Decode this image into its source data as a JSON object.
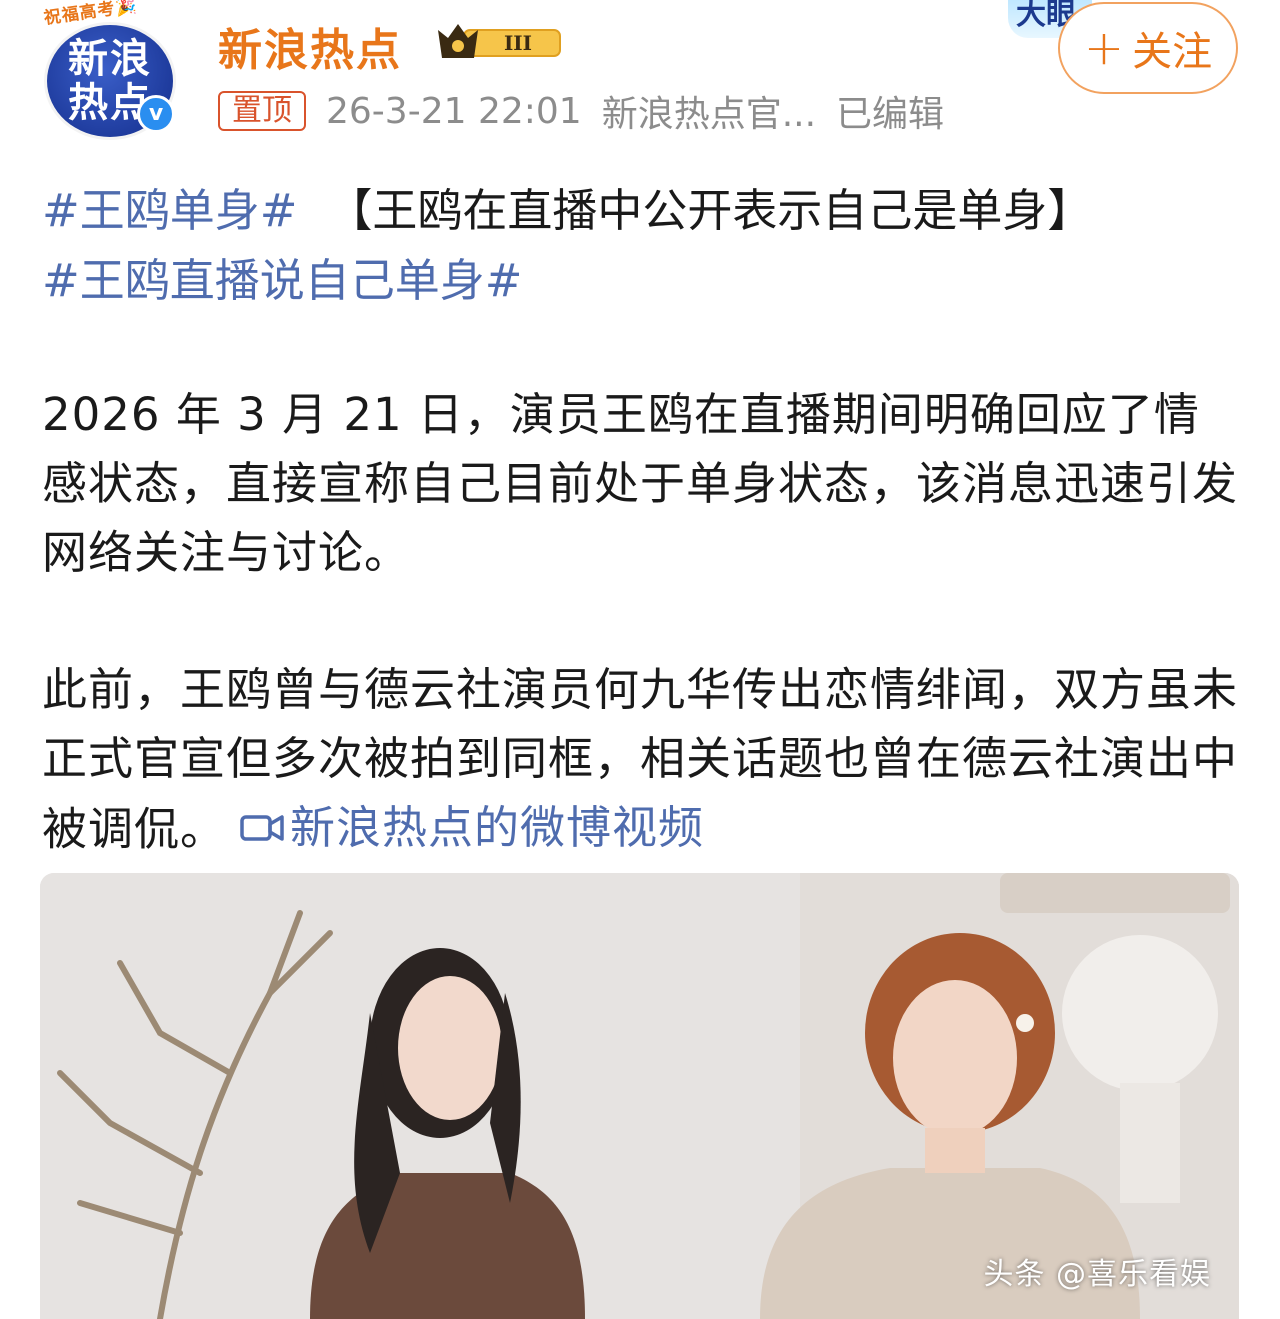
{
  "header": {
    "avatar_banner": "祝福高考🎉",
    "avatar_text_line1": "新浪",
    "avatar_text_line2": "热点",
    "avatar_verified": "v",
    "account_name": "新浪热点",
    "level_badge": "III",
    "pin_label": "置顶",
    "timestamp": "26-3-21 22:01",
    "source": "新浪热点官...",
    "edited_label": "已编辑",
    "follow_label": "关注",
    "follow_plus": "+",
    "badge_peek": "大眼"
  },
  "post": {
    "tag1": "#王鸥单身#",
    "headline": "【王鸥在直播中公开表示自己是单身】",
    "tag2": "#王鸥直播说自己单身#",
    "paragraph1": "2026 年 3 月 21 日，演员王鸥在直播期间明确回应了情感状态，直接宣称自己目前处于单身状态，该消息迅速引发网络关注与讨论。",
    "paragraph2": "此前，王鸥曾与德云社演员何九华传出恋情绯闻，双方虽未正式官宣但多次被拍到同框，相关话题也曾在德云社演出中被调侃。",
    "video_link_label": "新浪热点的微博视频"
  },
  "image": {
    "watermark": "头条 @喜乐看娱"
  },
  "colors": {
    "accent_orange": "#e8761a",
    "link_blue": "#4f6cae",
    "pin_red": "#d9532c",
    "meta_gray": "#8c8c8c"
  }
}
